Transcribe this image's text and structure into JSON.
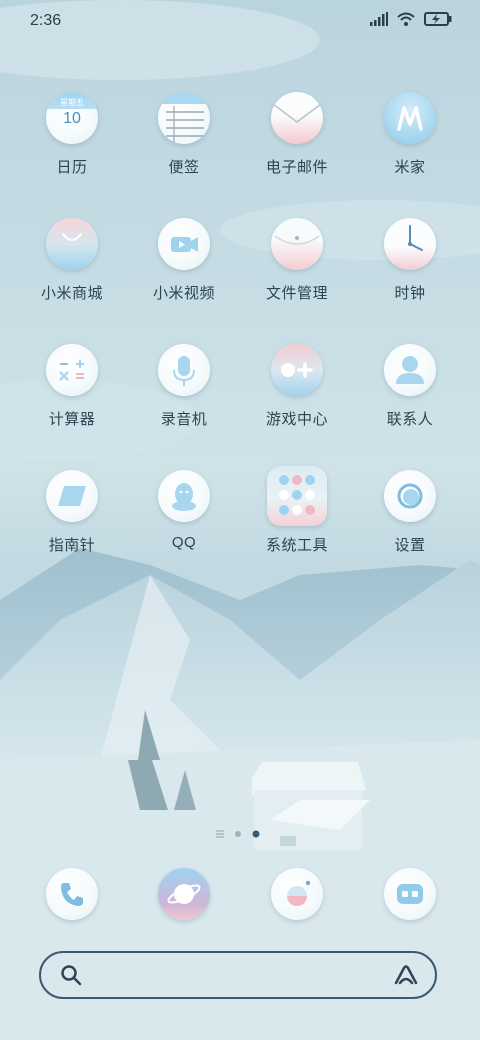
{
  "status_bar": {
    "time": "2:36",
    "icons": [
      "signal-icon",
      "wifi-icon",
      "battery-charging-icon"
    ]
  },
  "apps": [
    {
      "label": "日历",
      "icon": "calendar-icon",
      "calendar_weekday": "星期五",
      "calendar_day": "10"
    },
    {
      "label": "便签",
      "icon": "notes-icon"
    },
    {
      "label": "电子邮件",
      "icon": "mail-icon"
    },
    {
      "label": "米家",
      "icon": "mijia-icon"
    },
    {
      "label": "小米商城",
      "icon": "shopping-bag-icon"
    },
    {
      "label": "小米视频",
      "icon": "video-icon"
    },
    {
      "label": "文件管理",
      "icon": "folder-icon"
    },
    {
      "label": "时钟",
      "icon": "clock-icon"
    },
    {
      "label": "计算器",
      "icon": "calculator-icon"
    },
    {
      "label": "录音机",
      "icon": "microphone-icon"
    },
    {
      "label": "游戏中心",
      "icon": "game-center-icon"
    },
    {
      "label": "联系人",
      "icon": "contact-icon"
    },
    {
      "label": "指南针",
      "icon": "compass-icon"
    },
    {
      "label": "QQ",
      "icon": "qq-penguin-icon"
    },
    {
      "label": "系统工具",
      "icon": "folder-system-tools-icon"
    },
    {
      "label": "设置",
      "icon": "settings-icon"
    }
  ],
  "page_indicator": {
    "pages": 3,
    "current": 3
  },
  "dock": [
    {
      "icon": "phone-icon"
    },
    {
      "icon": "browser-planet-icon"
    },
    {
      "icon": "camera-icon"
    },
    {
      "icon": "messages-icon"
    }
  ],
  "search_bar": {
    "icons": [
      "search-icon",
      "xiao-ai-icon"
    ]
  },
  "colors": {
    "accent": "#3a5a72",
    "pink": "#f4c9cf",
    "blue": "#9fd3ef"
  }
}
